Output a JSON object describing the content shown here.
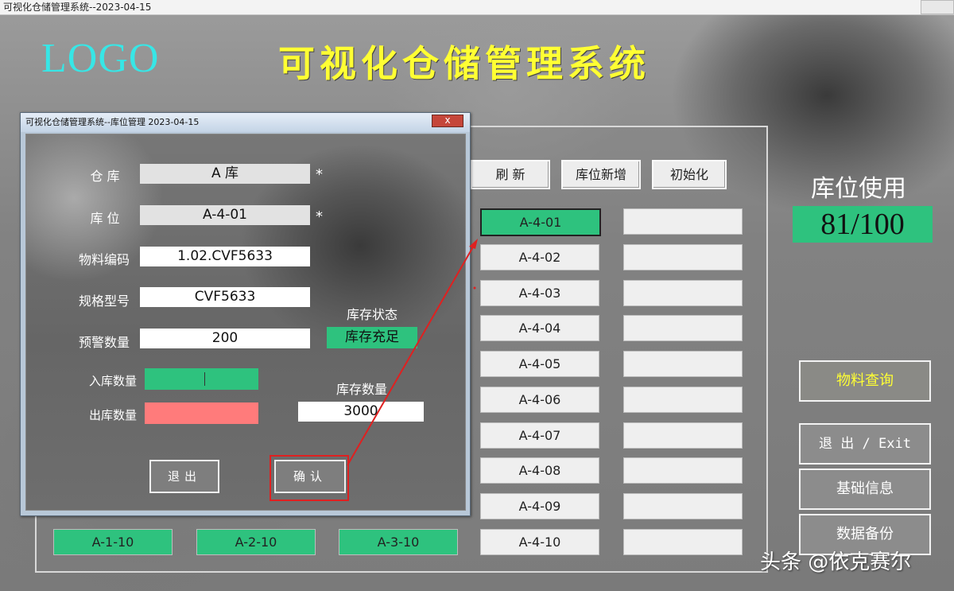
{
  "window": {
    "title": "可视化仓储管理系统--2023-04-15"
  },
  "header": {
    "logo": "LOGO",
    "app_title": "可视化仓储管理系统"
  },
  "toolbar": {
    "refresh": "刷 新",
    "add_slot": "库位新增",
    "init": "初始化"
  },
  "columns": {
    "col1_bottom": "A-1-10",
    "col2_bottom": "A-2-10",
    "col3_bottom": "A-3-10",
    "col4": [
      "A-4-01",
      "A-4-02",
      "A-4-03",
      "A-4-04",
      "A-4-05",
      "A-4-06",
      "A-4-07",
      "A-4-08",
      "A-4-09",
      "A-4-10"
    ]
  },
  "usage": {
    "label": "库位使用",
    "value": "81/100"
  },
  "side": {
    "query": "物料查询",
    "exit": "退 出 / Exit",
    "basic": "基础信息",
    "backup": "数据备份"
  },
  "dialog": {
    "title": "可视化仓储管理系统--库位管理 2023-04-15",
    "close": "x",
    "warehouse_label": "仓 库",
    "warehouse_value": "A 库",
    "slot_label": "库 位",
    "slot_value": "A-4-01",
    "material_label": "物料编码",
    "material_value": "1.02.CVF5633",
    "spec_label": "规格型号",
    "spec_value": "CVF5633",
    "warn_label": "预警数量",
    "warn_value": "200",
    "status_label": "库存状态",
    "status_value": "库存充足",
    "in_label": "入库数量",
    "out_label": "出库数量",
    "stock_label": "库存数量",
    "stock_value": "3000",
    "required_mark": "*",
    "exit_btn": "退出",
    "confirm_btn": "确认"
  },
  "watermark": "头条 @依克赛尔",
  "colors": {
    "green": "#2ec27e",
    "red": "#ff7b7b",
    "title_yellow": "#ffff33",
    "logo_cyan": "#37e6e6"
  }
}
